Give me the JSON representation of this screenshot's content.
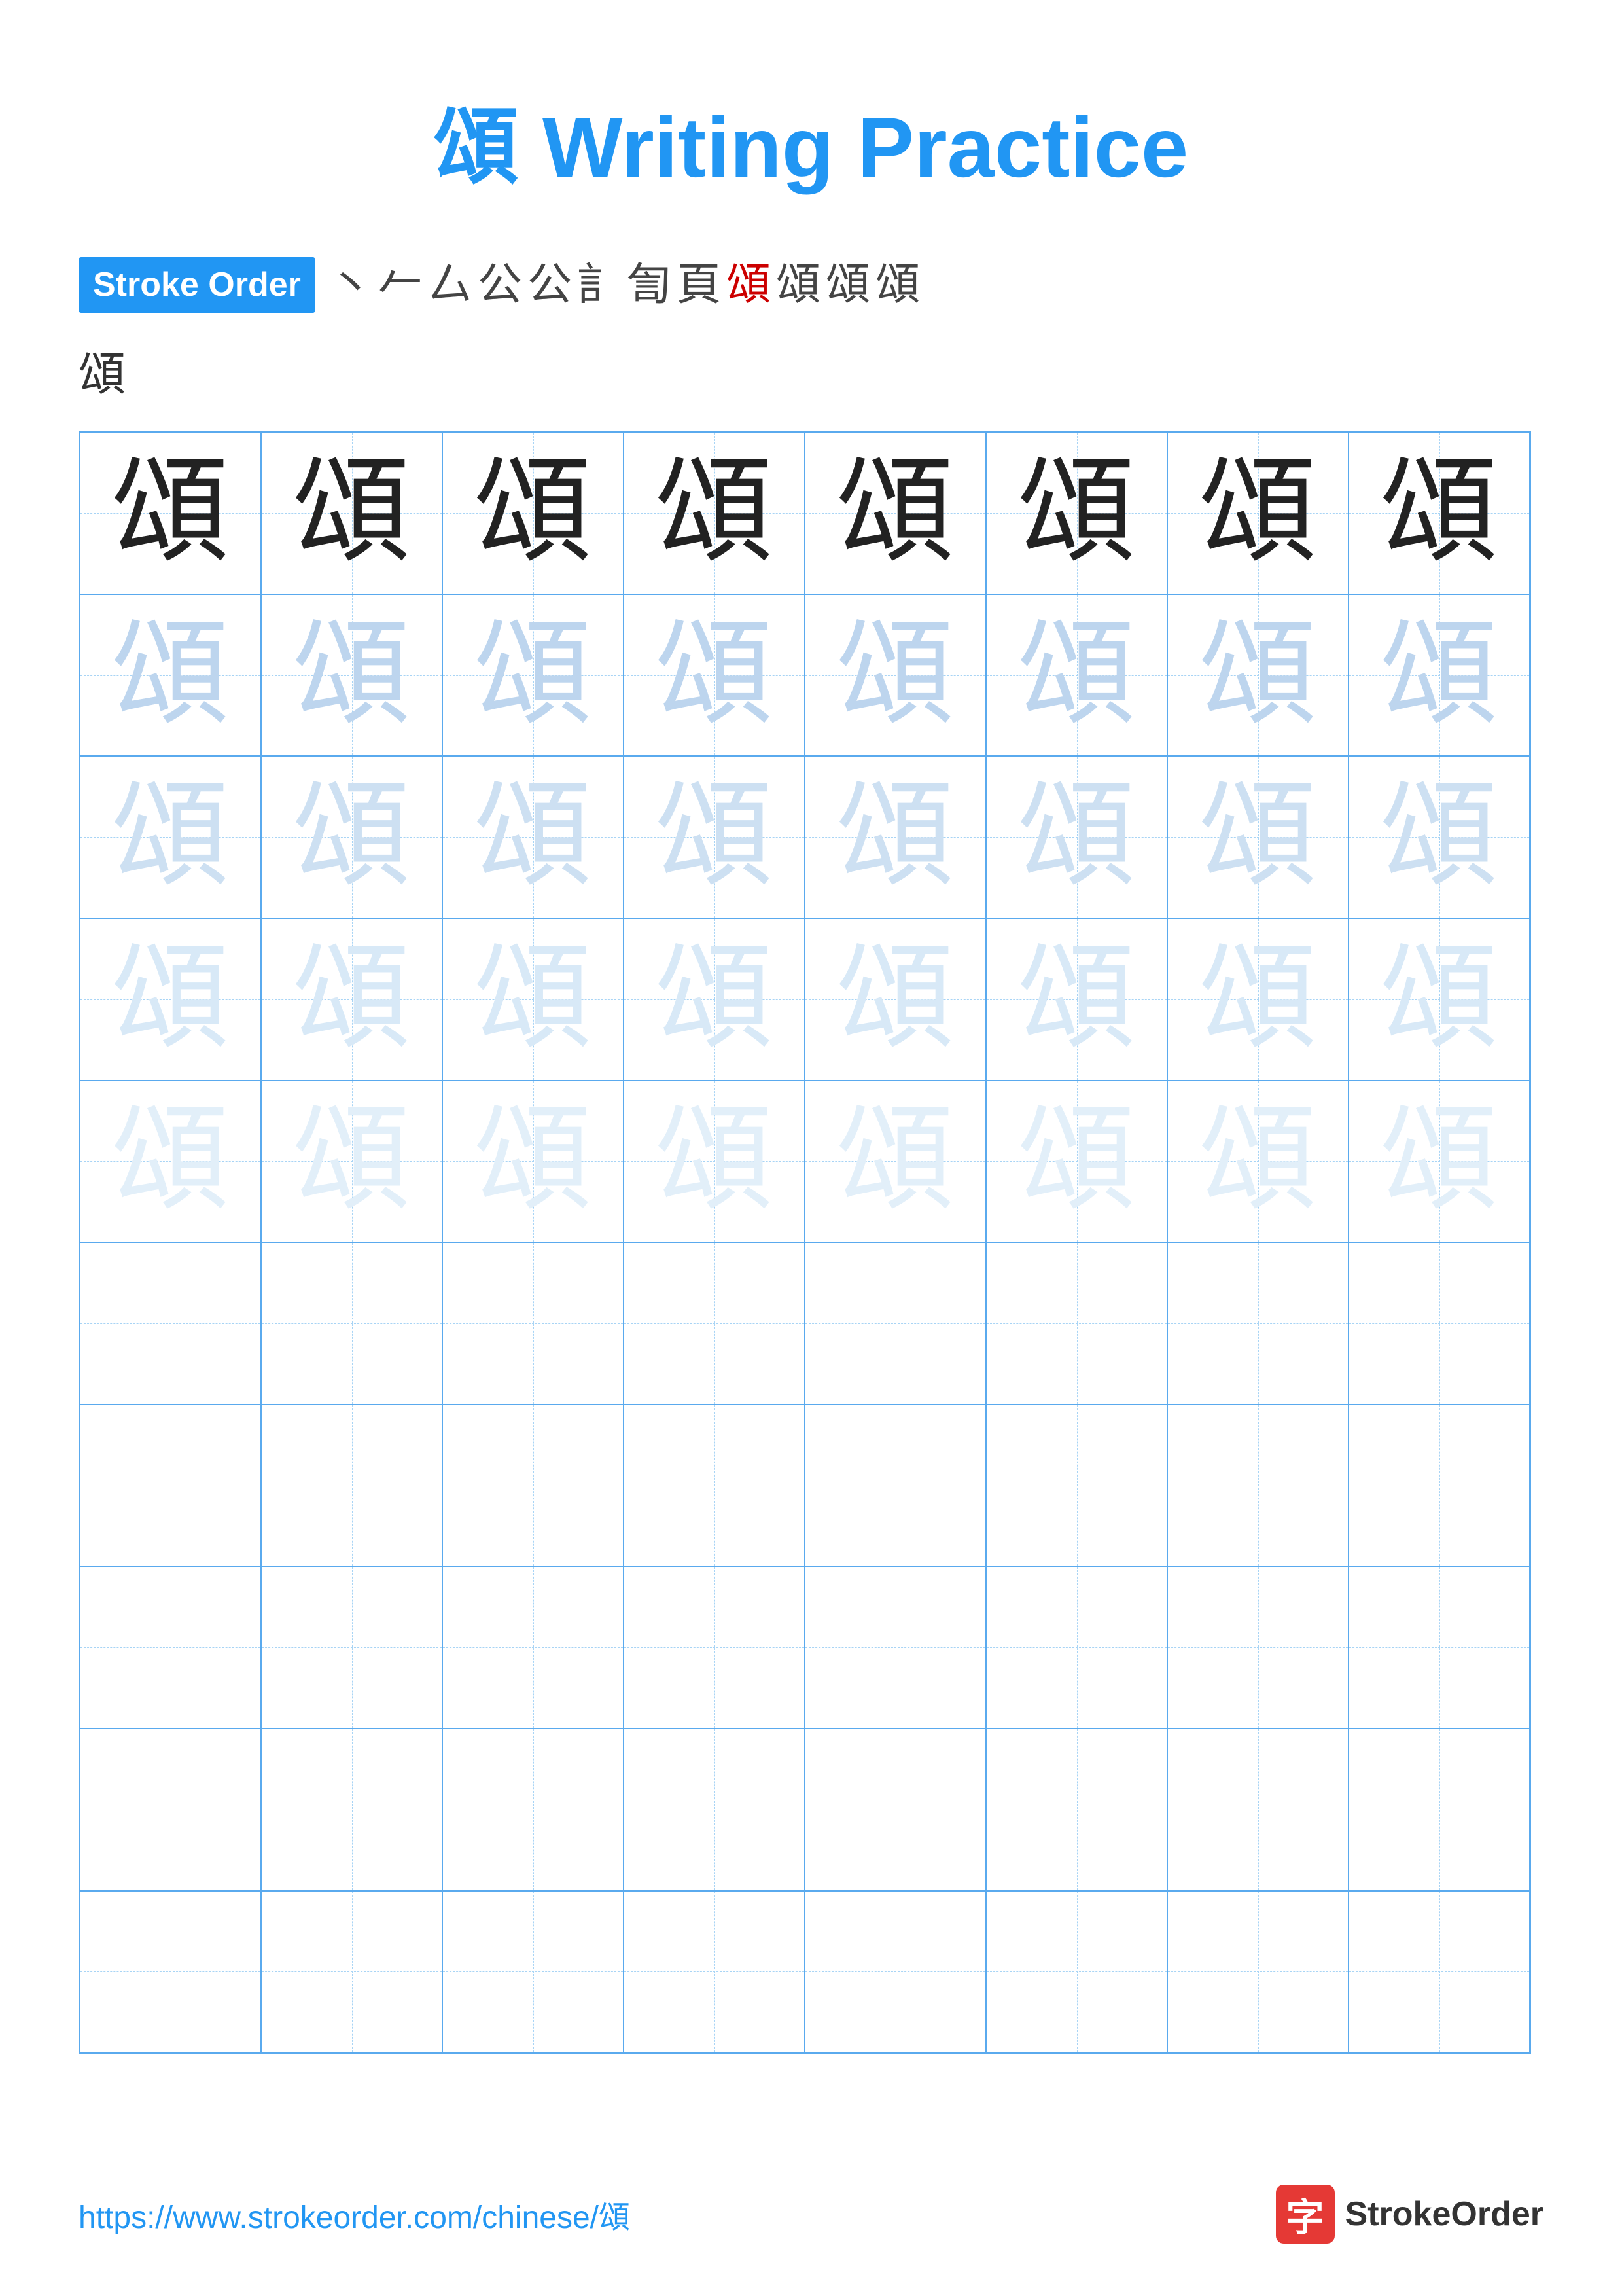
{
  "title": {
    "chinese_char": "頌",
    "rest": " Writing Practice",
    "full": "頌 Writing Practice"
  },
  "stroke_order": {
    "label": "Stroke Order",
    "strokes": [
      "丶",
      "ㄥ",
      "厶",
      "公",
      "公",
      "訁",
      "訂",
      "頁",
      "頌",
      "頌",
      "頌",
      "頌"
    ],
    "final_char": "頌"
  },
  "practice": {
    "character": "頌",
    "rows": 10,
    "cols": 8,
    "filled_rows": 5,
    "shade_levels": [
      "dark",
      "light1",
      "light2",
      "light3",
      "light4"
    ]
  },
  "footer": {
    "url": "https://www.strokeorder.com/chinese/頌",
    "brand": "StrokeOrder",
    "logo_char": "字"
  }
}
